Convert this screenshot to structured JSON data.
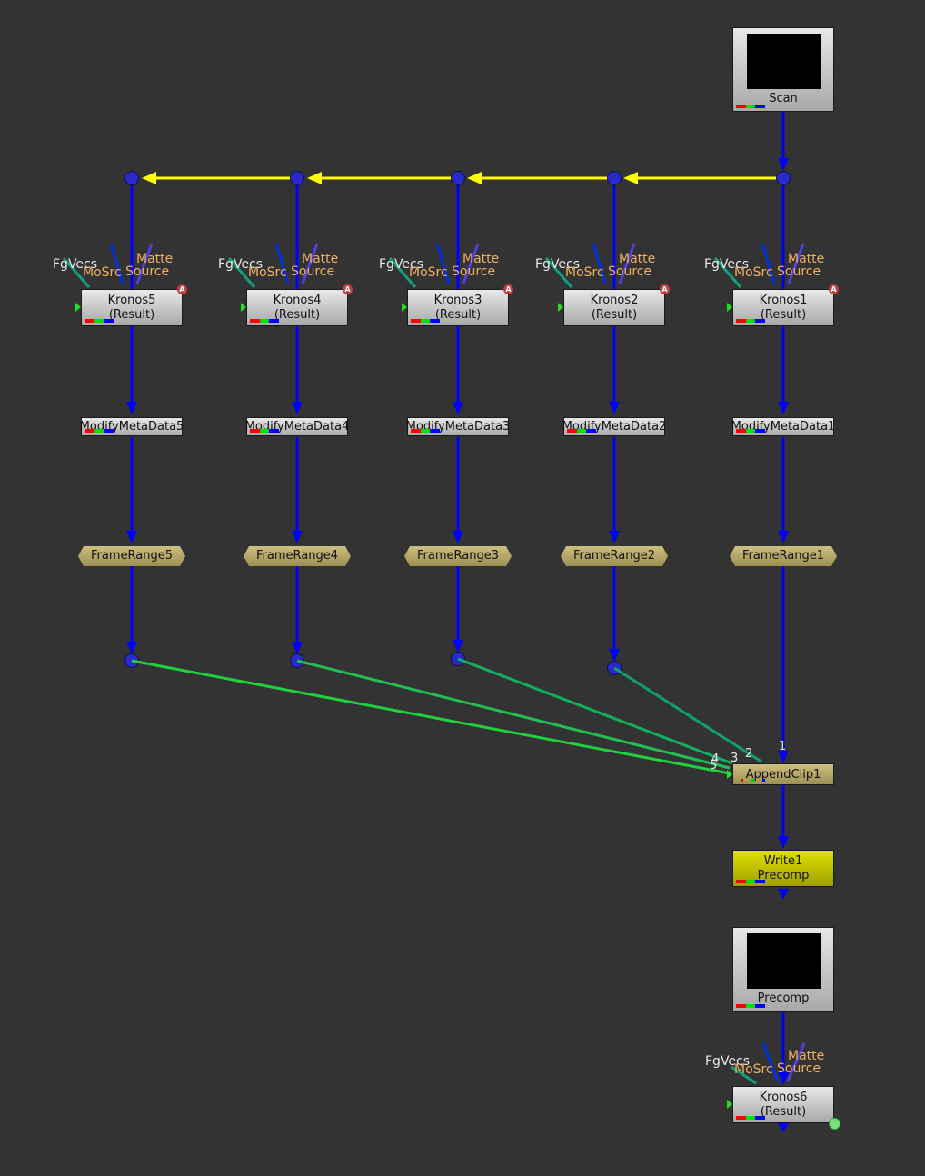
{
  "app": "Node Graph",
  "colors": {
    "background": "#333333",
    "pipe_main": "#0000ff",
    "pipe_expression": "#ffff00",
    "pipe_append": "#20e040",
    "pipe_append_alt": "#10a070",
    "dot": "#2a2ac8",
    "node_gray": "#c8c8c8",
    "node_framerange": "#b8aa6a",
    "node_write": "#d0d000"
  },
  "nodes": {
    "scan": {
      "label": "Scan",
      "type": "Read"
    },
    "precomp_read": {
      "label": "Precomp",
      "type": "Read"
    },
    "kronos": [
      {
        "name": "Kronos5",
        "sub": "(Result)",
        "badge": "A",
        "has_channels": true
      },
      {
        "name": "Kronos4",
        "sub": "(Result)",
        "badge": "A",
        "has_channels": true
      },
      {
        "name": "Kronos3",
        "sub": "(Result)",
        "badge": "A",
        "has_channels": true
      },
      {
        "name": "Kronos2",
        "sub": "(Result)",
        "badge": "A",
        "has_channels": false
      },
      {
        "name": "Kronos1",
        "sub": "(Result)",
        "badge": "A",
        "has_channels": true
      }
    ],
    "kronos6": {
      "name": "Kronos6",
      "sub": "(Result)"
    },
    "kronos_inputs": {
      "fgvecs": "FgVecs",
      "mosrc": "MoSrc",
      "matte": "Matte",
      "source": "Source"
    },
    "modify": [
      "ModifyMetaData5",
      "ModifyMetaData4",
      "ModifyMetaData3",
      "ModifyMetaData2",
      "ModifyMetaData1"
    ],
    "framerange": [
      "FrameRange5",
      "FrameRange4",
      "FrameRange3",
      "FrameRange2",
      "FrameRange1"
    ],
    "append": {
      "label": "AppendClip1",
      "inputs": [
        "1",
        "2",
        "3",
        "4",
        "5"
      ]
    },
    "write": {
      "name": "Write1",
      "sub": "Precomp"
    }
  }
}
